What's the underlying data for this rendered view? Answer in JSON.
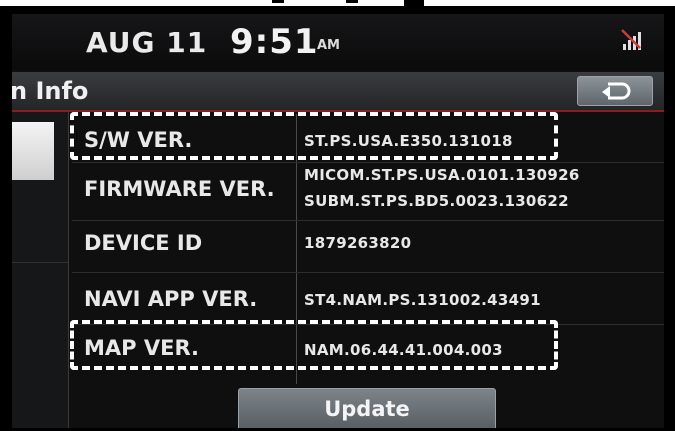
{
  "status_bar": {
    "date": "AUG 11",
    "time": "9:51",
    "ampm": "AM",
    "signal_icon": "no-signal-icon"
  },
  "title_bar": {
    "title": "n Info",
    "back_icon": "back-arrow-icon"
  },
  "info_rows": [
    {
      "label": "S/W VER.",
      "value": "ST.PS.USA.E350.131018"
    },
    {
      "label": "FIRMWARE VER.",
      "value_line1": "MICOM.ST.PS.USA.0101.130926",
      "value_line2": "SUBM.ST.PS.BD5.0023.130622"
    },
    {
      "label": "DEVICE ID",
      "value": "1879263820"
    },
    {
      "label": "NAVI APP VER.",
      "value": "ST4.NAM.PS.131002.43491"
    },
    {
      "label": "MAP VER.",
      "value": "NAM.06.44.41.004.003"
    }
  ],
  "update_button": {
    "label": "Update"
  },
  "colors": {
    "accent_red": "#8a1e1e",
    "screen_bg": "#0f0f10",
    "button_gray": "#6a7277"
  }
}
